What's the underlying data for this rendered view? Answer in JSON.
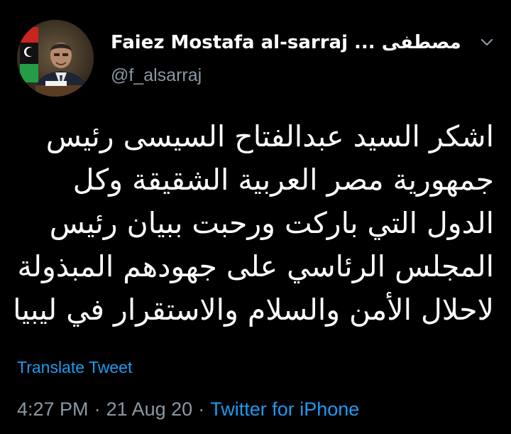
{
  "tweet": {
    "author": {
      "display_name": "Faiez Mostafa al-sarraj ... فائز مصطفى",
      "handle": "@f_alsarraj",
      "avatar_icon": "profile-photo"
    },
    "menu_icon": "chevron-down-icon",
    "text": "اشكر السيد عبدالفتاح السيسى رئيس جمهورية مصر العربية الشقيقة وكل  الدول التي باركت ورحبت ببيان رئيس المجلس الرئاسي على جهودهم المبذولة لاحلال الأمن والسلام والاستقرار في ليبيا",
    "translate_label": "Translate Tweet",
    "time": "4:27 PM",
    "date": "21 Aug 20",
    "separator": "·",
    "source": "Twitter for iPhone"
  },
  "colors": {
    "background": "#000000",
    "text_primary": "#ffffff",
    "text_secondary": "#8b98a5",
    "link": "#1d9bf0"
  }
}
